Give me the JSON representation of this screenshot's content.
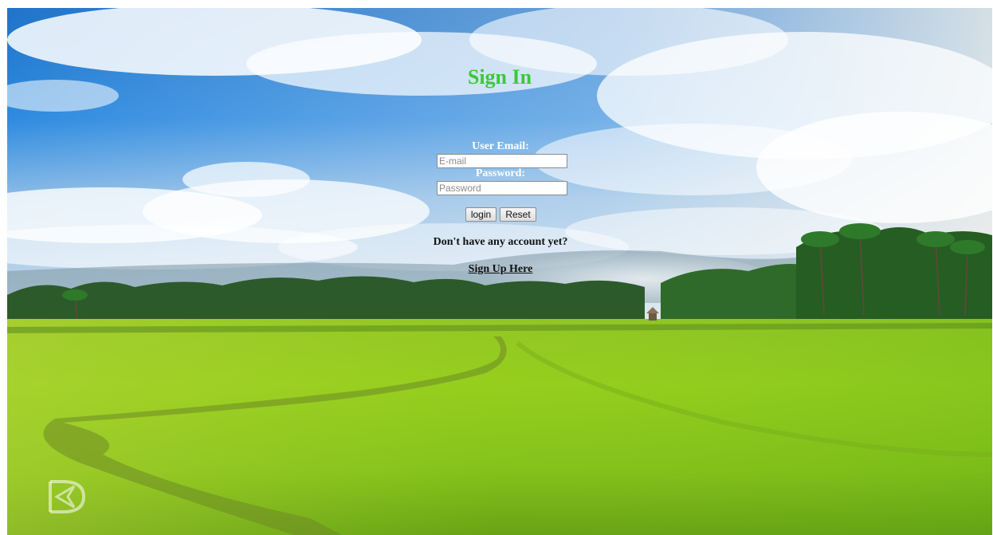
{
  "form": {
    "title": "Sign In",
    "email_label": "User Email:",
    "email_placeholder": "E-mail",
    "email_value": "",
    "password_label": "Password:",
    "password_placeholder": "Password",
    "password_value": "",
    "login_label": "login",
    "reset_label": "Reset",
    "no_account_text": "Don't have any account yet?",
    "signup_link_label": "Sign Up Here"
  },
  "colors": {
    "title": "#3cc83a",
    "label": "#ffffff",
    "body_text": "#111111"
  },
  "background": {
    "scene": "rice-field-landscape-with-sky"
  },
  "watermark": {
    "icon": "watermark-logo-icon"
  }
}
